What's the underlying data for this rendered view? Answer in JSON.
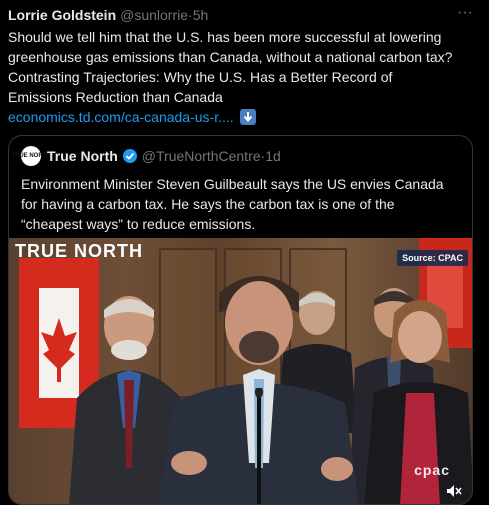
{
  "tweet": {
    "author_name": "Lorrie Goldstein",
    "author_handle": "@sunlorrie",
    "dot": "·",
    "time": "5h",
    "more_icon": "more-icon",
    "text_lines": [
      "Should we tell him that the U.S. has been more successful at lowering",
      "greenhouse gas emissions than Canada, without a national carbon tax?",
      "Contrasting Trajectories: Why the U.S. Has a Better Record of",
      "Emissions Reduction than Canada"
    ],
    "link": "economics.td.com/ca-canada-us-r....",
    "link_icon": "down-arrow-icon"
  },
  "quote": {
    "avatar_text": "TRUE NORTH",
    "name": "True North",
    "handle": "@TrueNorthCentre",
    "dot": "·",
    "time": "1d",
    "text_lines": [
      "Environment Minister Steven Guilbeault says the US envies Canada",
      "for having a carbon tax. He says the carbon tax is one of the",
      "“cheapest ways” to reduce emissions."
    ],
    "video": {
      "brand_logo": "TRUE NORTH",
      "source_label": "Source: CPAC",
      "watermark": "cpac",
      "mute_icon": "mute-icon"
    }
  },
  "colors": {
    "background": "#000000",
    "text": "#e7e9ea",
    "secondary": "#71767b",
    "link": "#1d9bf0",
    "border": "#333639"
  }
}
